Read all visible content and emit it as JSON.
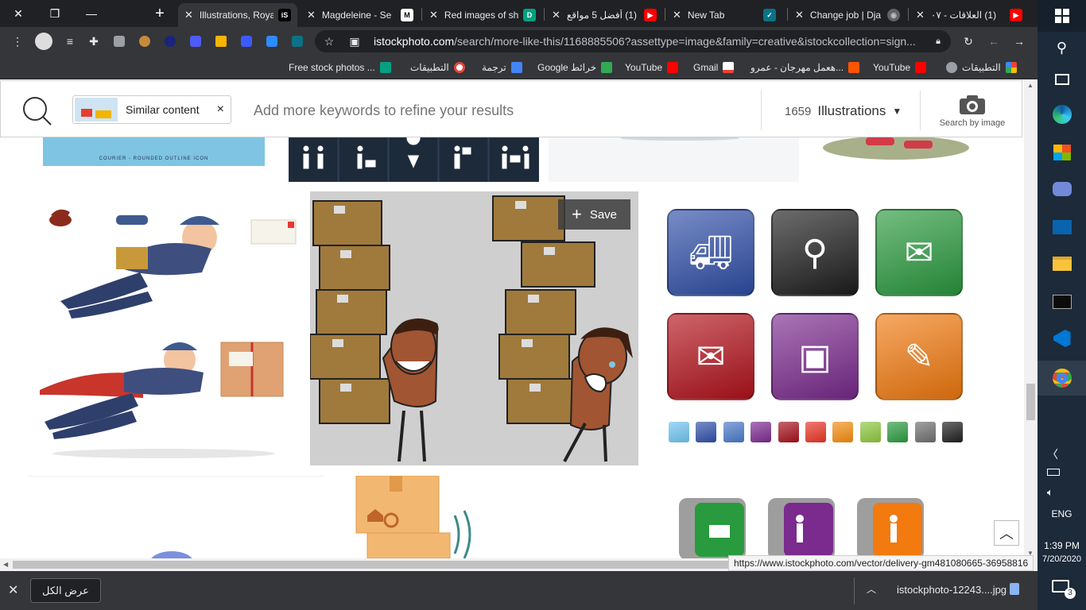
{
  "tabs": [
    {
      "title": "Illustrations, Royal",
      "favicon": "iS",
      "favicon_color": "#ffffff",
      "favicon_bg": "#000000"
    },
    {
      "title": "Magdeleine - Se",
      "favicon": "M",
      "favicon_color": "#000000",
      "favicon_bg": "#ffffff"
    },
    {
      "title": "Red images of sh",
      "favicon": "D",
      "favicon_color": "#ffffff",
      "favicon_bg": "#05a081"
    },
    {
      "title": "(1) أفضل 5 مواقع",
      "favicon": "▶",
      "favicon_color": "#ffffff",
      "favicon_bg": "#ff0000"
    },
    {
      "title": "New Tab",
      "favicon": "",
      "favicon_color": "#ffffff",
      "favicon_bg": "#35363a"
    },
    {
      "title": "",
      "favicon": "✓",
      "favicon_color": "#ffffff",
      "favicon_bg": "#0b7285"
    },
    {
      "title": "Change job | Dja",
      "favicon": "◉",
      "favicon_color": "#bbbbbb",
      "favicon_bg": "#5f6368"
    },
    {
      "title": "(1) العلاقات - ٠٧",
      "favicon": "▶",
      "favicon_color": "#ffffff",
      "favicon_bg": "#ff0000"
    }
  ],
  "new_tab_label": "+",
  "address": {
    "host": "istockphoto.com",
    "path": "/search/more-like-this/1168885506?assettype=image&family=creative&istockcollection=sign..."
  },
  "bookmarks": [
    {
      "label": "Free stock photos ...",
      "color": "#05a081"
    },
    {
      "label": "التطبيقات",
      "color": "#ea4335"
    },
    {
      "label": "ترجمة",
      "color": "#4285f4"
    },
    {
      "label": "Google خرائط",
      "color": "#34a853"
    },
    {
      "label": "YouTube",
      "color": "#ff0000"
    },
    {
      "label": "Gmail",
      "color": "#ea4335"
    },
    {
      "label": "هعمل مهرجان - عمرو...",
      "color": "#ff5500"
    },
    {
      "label": "YouTube",
      "color": "#ff0000"
    },
    {
      "label": "التطبيقات",
      "color": "#fbbc05"
    }
  ],
  "search": {
    "chip_label": "Similar content",
    "chip_close": "×",
    "placeholder": "Add more keywords to refine your results",
    "count": "1659",
    "filter_label": "Illustrations",
    "search_by_image": "Search by image"
  },
  "partial_card_caption": "COURIER - ROUNDED OUTLINE ICON",
  "save_label": "Save",
  "status_url": "https://www.istockphoto.com/vector/delivery-gm481080665-36958816",
  "download": {
    "show_all": "عرض الكل",
    "filename": "istockphoto-12243....jpg"
  },
  "taskbar": {
    "lang": "ENG",
    "time": "1:39 PM",
    "date": "7/20/2020",
    "notifications": "3"
  },
  "colors": {
    "brand_blue": "#1a73e8",
    "icon_tiles": [
      "#2f4fa8",
      "#1e1e1e",
      "#2a9a3e",
      "#b3121b",
      "#7b2a8e",
      "#f27a0f"
    ],
    "swatches": [
      "#6ec3ee",
      "#2f4fa8",
      "#4a78c8",
      "#7b2a8e",
      "#a5101b",
      "#e83424",
      "#f28c0f",
      "#8cc63e",
      "#2a9a3e",
      "#6e6e6e",
      "#1e1e1e"
    ]
  }
}
